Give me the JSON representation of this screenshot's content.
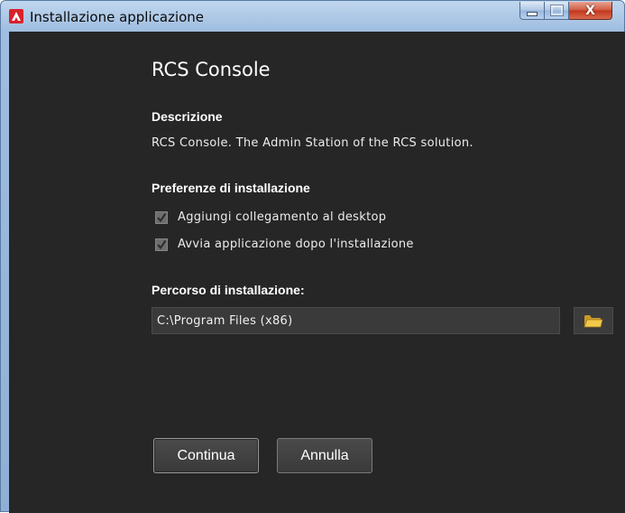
{
  "window": {
    "title": "Installazione applicazione",
    "close_glyph": "X",
    "app_icon": "adobe-air-icon",
    "accent": "#d8202a"
  },
  "app": {
    "name": "RCS Console"
  },
  "description": {
    "heading": "Descrizione",
    "text": "RCS Console. The Admin Station of the RCS solution."
  },
  "preferences": {
    "heading": "Preferenze di installazione",
    "options": [
      {
        "label": "Aggiungi collegamento al desktop",
        "checked": true
      },
      {
        "label": "Avvia applicazione dopo l'installazione",
        "checked": true
      }
    ]
  },
  "install_path": {
    "heading": "Percorso di installazione:",
    "value": "C:\\Program Files (x86)",
    "browse_icon": "folder-icon"
  },
  "buttons": {
    "continue": "Continua",
    "cancel": "Annulla"
  }
}
